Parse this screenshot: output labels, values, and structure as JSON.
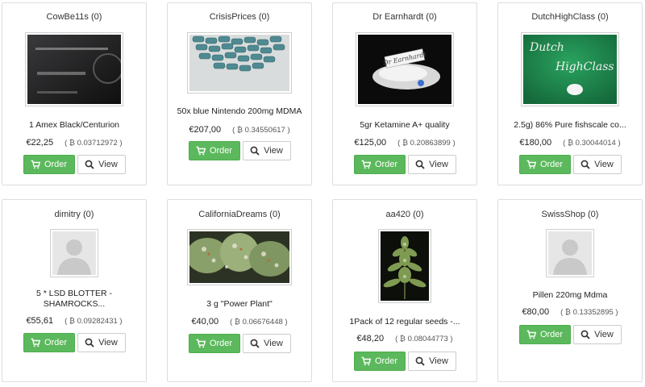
{
  "colors": {
    "order_button": "#5cb85c",
    "card_border": "#dddddd"
  },
  "icons": {
    "order": "shopping-cart-icon",
    "view": "search-icon",
    "btc": "bitcoin-symbol"
  },
  "listings": [
    {
      "seller": "CowBe11s (0)",
      "title": "1 Amex Black/Centurion",
      "price_eur": "€22,25",
      "price_btc": "( ₿ 0.03712972 )",
      "order_label": "Order",
      "view_label": "View",
      "image": "black credit card"
    },
    {
      "seller": "CrisisPrices (0)",
      "title": "50x blue Nintendo 200mg MDMA",
      "price_eur": "€207,00",
      "price_btc": "( ₿ 0.34550617 )",
      "order_label": "Order",
      "view_label": "View",
      "image": "blue pills"
    },
    {
      "seller": "Dr Earnhardt (0)",
      "title": "5gr Ketamine A+ quality",
      "price_eur": "€125,00",
      "price_btc": "( ₿ 0.20863899 )",
      "order_label": "Order",
      "view_label": "View",
      "image": "white powder with label"
    },
    {
      "seller": "DutchHighClass (0)",
      "title": "2.5g) 86% Pure fishscale co...",
      "price_eur": "€180,00",
      "price_btc": "( ₿ 0.30044014 )",
      "order_label": "Order",
      "view_label": "View",
      "image": "green sign",
      "image_text": [
        "Dutch",
        "HighClass"
      ]
    },
    {
      "seller": "dimitry (0)",
      "title": "5 * LSD BLOTTER - SHAMROCKS...",
      "price_eur": "€55,61",
      "price_btc": "( ₿ 0.09282431 )",
      "order_label": "Order",
      "view_label": "View",
      "image": "avatar placeholder"
    },
    {
      "seller": "CaliforniaDreams (0)",
      "title": "3 g \"Power Plant\"",
      "price_eur": "€40,00",
      "price_btc": "( ₿ 0.06676448 )",
      "order_label": "Order",
      "view_label": "View",
      "image": "cannabis buds"
    },
    {
      "seller": "aa420 (0)",
      "title": "1Pack of 12 regular seeds -...",
      "price_eur": "€48,20",
      "price_btc": "( ₿ 0.08044773 )",
      "order_label": "Order",
      "view_label": "View",
      "image": "cannabis plant"
    },
    {
      "seller": "SwissShop (0)",
      "title": "Pillen 220mg Mdma",
      "price_eur": "€80,00",
      "price_btc": "( ₿ 0.13352895 )",
      "order_label": "Order",
      "view_label": "View",
      "image": "avatar placeholder"
    }
  ]
}
